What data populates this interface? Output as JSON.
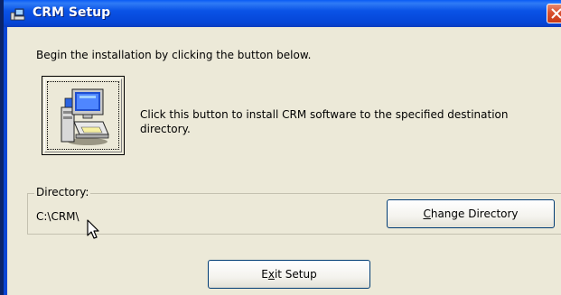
{
  "window": {
    "title": "CRM Setup",
    "icons": {
      "title_icon": "setup-computer-icon",
      "close_icon": "close-x-icon",
      "install_icon": "computer-install-icon",
      "cursor": "mouse-pointer-icon"
    },
    "colors": {
      "title_bar": "#0545d6",
      "dialog_bg": "#ece9d8",
      "close_button": "#d9502f"
    }
  },
  "intro": {
    "text": "Begin the installation by clicking the button below."
  },
  "install": {
    "description": "Click this button to install CRM software to the specified destination directory."
  },
  "directory": {
    "legend": "Directory:",
    "value": "C:\\CRM\\",
    "change_button": {
      "prefix": "",
      "underlined": "C",
      "rest": "hange Directory"
    }
  },
  "exit_button": {
    "prefix": "E",
    "underlined": "x",
    "rest": "it Setup"
  }
}
